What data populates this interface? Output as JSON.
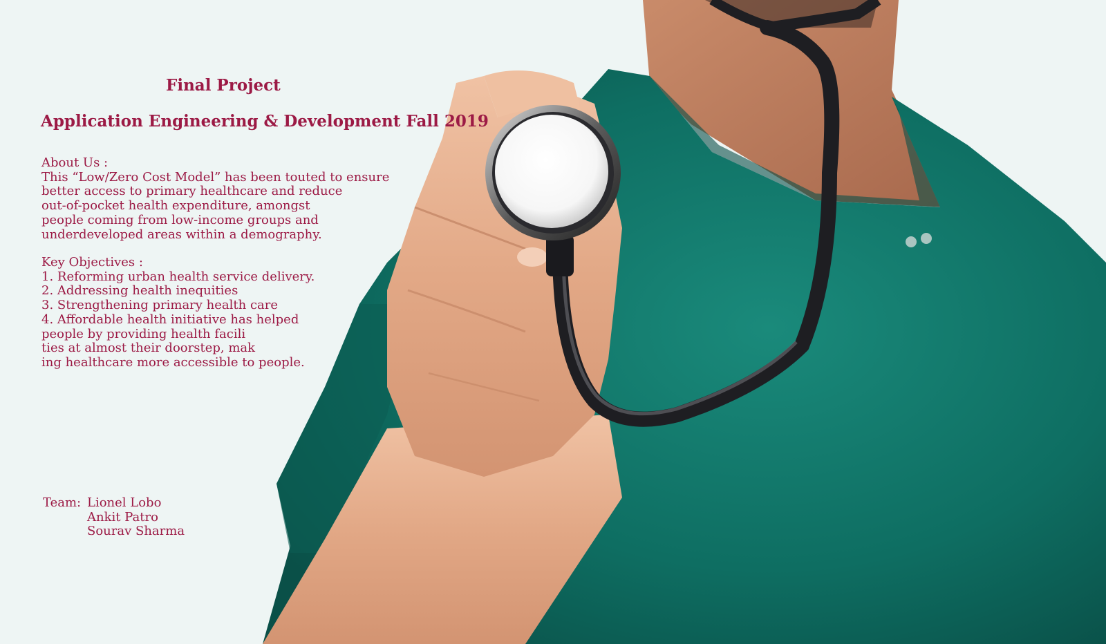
{
  "slide": {
    "title": "Final Project",
    "subtitle": "Application Engineering & Development Fall 2019",
    "about": {
      "heading": "About Us :",
      "lines": [
        "This “Low/Zero Cost Model” has been touted to ensure",
        "better access to primary healthcare and reduce",
        "out-of-pocket health expenditure, amongst",
        "people coming from low-income groups and",
        "underdeveloped areas within a demography."
      ]
    },
    "objectives": {
      "heading": "Key Objectives :",
      "lines": [
        "1. Reforming urban health service delivery.",
        "2. Addressing health inequities",
        "3. Strengthening primary health care",
        "4. Affordable health initiative has helped",
        "people by providing health facili",
        "ties at almost their doorstep, mak",
        "ing healthcare more accessible to people."
      ]
    },
    "team": {
      "label": "Team:",
      "members": [
        "Lionel Lobo",
        "Ankit Patro",
        "Sourav Sharma"
      ]
    }
  },
  "colors": {
    "text": "#9c1a45",
    "background": "#eef5f4",
    "scrubs": "#0e6e62",
    "skin": "#d9a382"
  },
  "image": {
    "subject": "doctor-holding-stethoscope-photo"
  }
}
